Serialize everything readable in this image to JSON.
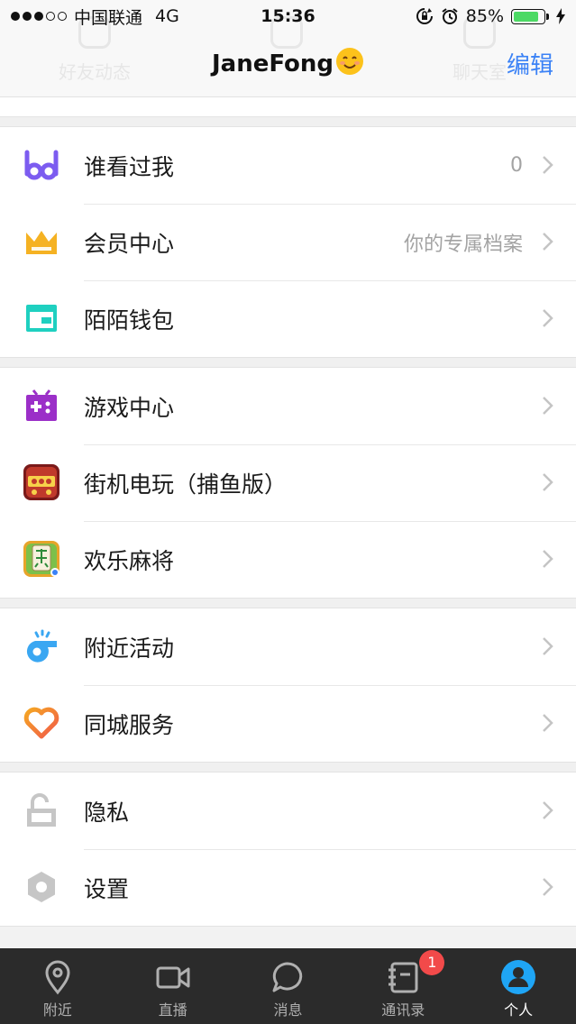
{
  "status_bar": {
    "carrier": "中国联通",
    "network": "4G",
    "time": "15:36",
    "battery_text": "85%",
    "battery_level": 0.85
  },
  "header": {
    "title": "JaneFong",
    "edit_label": "编辑",
    "ghost_tabs": [
      "好友动态",
      "",
      "聊天室"
    ]
  },
  "menu": {
    "who_viewed": {
      "label": "谁看过我",
      "value": "0",
      "icon": "glasses-icon"
    },
    "vip_center": {
      "label": "会员中心",
      "value": "你的专属档案",
      "icon": "crown-icon"
    },
    "wallet": {
      "label": "陌陌钱包",
      "icon": "wallet-icon"
    },
    "game_center": {
      "label": "游戏中心",
      "icon": "gamepad-icon"
    },
    "arcade": {
      "label": "街机电玩（捕鱼版）",
      "icon": "arcade-game-icon"
    },
    "mahjong": {
      "label": "欢乐麻将",
      "icon": "mahjong-icon"
    },
    "nearby_events": {
      "label": "附近活动",
      "icon": "whistle-icon"
    },
    "city_services": {
      "label": "同城服务",
      "icon": "heart-icon"
    },
    "privacy": {
      "label": "隐私",
      "icon": "lock-icon"
    },
    "settings": {
      "label": "设置",
      "icon": "hexagon-gear-icon"
    }
  },
  "tabbar": {
    "nearby": "附近",
    "live": "直播",
    "messages": "消息",
    "contacts": "通讯录",
    "contacts_badge": "1",
    "profile": "个人"
  },
  "colors": {
    "accent_blue": "#3b82f6",
    "purple": "#7c5cf0",
    "gold": "#f5b223",
    "teal": "#1fd0c0",
    "game_purple": "#9b2fc8",
    "whistle_blue": "#3aa7f2",
    "badge_red": "#f24a4a",
    "tabbar_bg": "#2b2b2b"
  }
}
